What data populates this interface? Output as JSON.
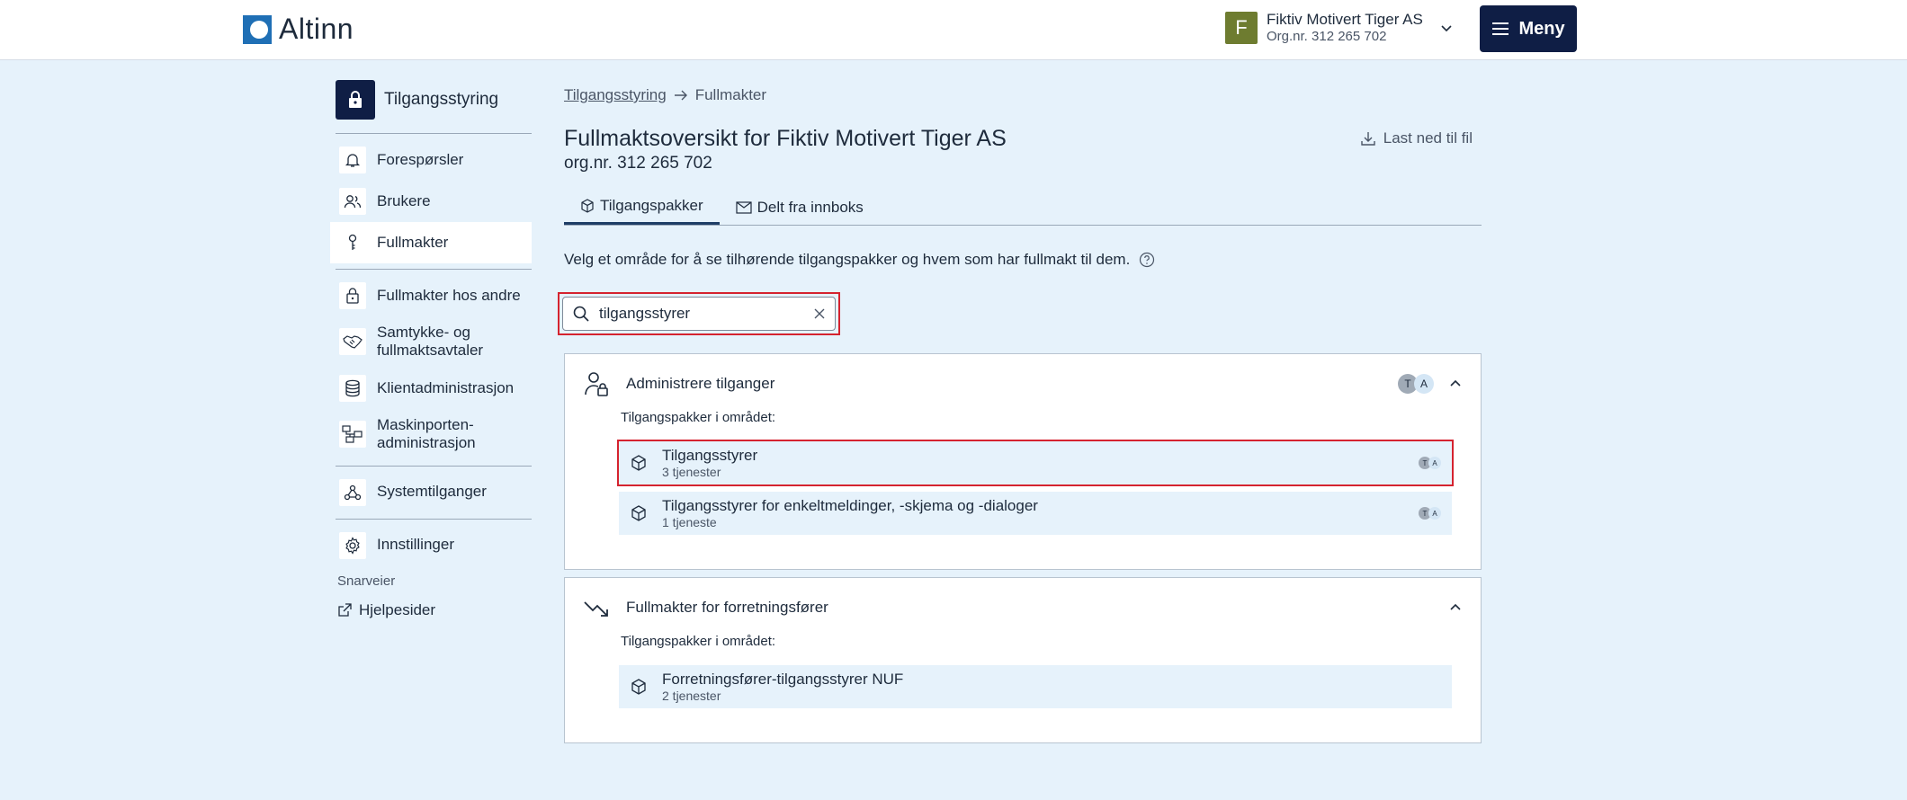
{
  "header": {
    "logo_text": "Altinn",
    "org_initial": "F",
    "org_name": "Fiktiv Motivert Tiger AS",
    "org_nr": "Org.nr. 312 265 702",
    "menu_label": "Meny",
    "org_avatar_color": "#6e7c30",
    "menu_color": "#0f1e45"
  },
  "sidebar": {
    "title": "Tilgangsstyring",
    "items": [
      {
        "label": "Forespørsler",
        "icon": "bell-icon"
      },
      {
        "label": "Brukere",
        "icon": "users-icon"
      },
      {
        "label": "Fullmakter",
        "icon": "key-icon",
        "active": true
      },
      {
        "label": "Fullmakter hos andre",
        "icon": "padlock-icon"
      },
      {
        "label": "Samtykke- og fullmaktsavtaler",
        "icon": "handshake-icon"
      },
      {
        "label": "Klientadministrasjon",
        "icon": "database-icon"
      },
      {
        "label": "Maskinporten-administrasjon",
        "icon": "network-icon"
      },
      {
        "label": "Systemtilganger",
        "icon": "nodes-icon"
      },
      {
        "label": "Innstillinger",
        "icon": "gear-icon"
      }
    ],
    "shortcuts_label": "Snarveier",
    "help_label": "Hjelpesider"
  },
  "main": {
    "breadcrumb_root": "Tilgangsstyring",
    "breadcrumb_current": "Fullmakter",
    "title": "Fullmaktsoversikt for Fiktiv Motivert Tiger AS",
    "subtitle": "org.nr. 312 265 702",
    "download_label": "Last ned til fil",
    "tabs": [
      {
        "label": "Tilgangspakker",
        "active": true
      },
      {
        "label": "Delt fra innboks",
        "active": false
      }
    ],
    "intro": "Velg et område for å se tilhørende tilgangspakker og hvem som har fullmakt til dem.",
    "search_value": "tilgangsstyrer",
    "panels": [
      {
        "title": "Administrere tilganger",
        "sub_label": "Tilgangspakker i området:",
        "badges": [
          "T",
          "A"
        ],
        "packages": [
          {
            "title": "Tilgangsstyrer",
            "count": "3 tjenester",
            "selected": true
          },
          {
            "title": "Tilgangsstyrer for enkeltmeldinger, -skjema og -dialoger",
            "count": "1 tjeneste"
          }
        ]
      },
      {
        "title": "Fullmakter for forretningsfører",
        "sub_label": "Tilgangspakker i området:",
        "packages": [
          {
            "title": "Forretningsfører-tilgangsstyrer NUF",
            "count": "2 tjenester"
          }
        ]
      }
    ]
  }
}
